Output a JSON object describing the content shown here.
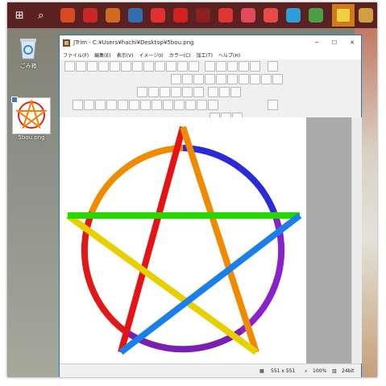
{
  "window": {
    "title": "JTrim - C:¥Users¥hachi¥Desktop¥5bou.png",
    "min_glyph": "─",
    "max_glyph": "☐",
    "close_glyph": "✕"
  },
  "menu": [
    {
      "label": "ファイル(F)"
    },
    {
      "label": "編集(E)"
    },
    {
      "label": "表示(V)"
    },
    {
      "label": "イメージ(I)"
    },
    {
      "label": "カラー(C)"
    },
    {
      "label": "加工(T)"
    },
    {
      "label": "ヘルプ(H)"
    }
  ],
  "taskbar": {
    "start_glyph": "⊞",
    "search_glyph": "⌕",
    "apps": [
      "#d94a20",
      "#c82828",
      "#d06a20",
      "#2f6fb0",
      "#e23030",
      "#d02020",
      "#8a2020",
      "#e03535",
      "#e24a5a",
      "#e84a4a",
      "#2f9ed8",
      "#47a047",
      "#cf7a20",
      "#d0a040"
    ]
  },
  "desktop": {
    "recycle_label": "ごみ箱",
    "file_label": "5bou.png"
  },
  "status": {
    "size": "551 x 551",
    "zoom": "100%",
    "depth": "24bit"
  },
  "colors": {
    "title_border": "#2a75c2",
    "taskbar_bg": "#5b2120"
  }
}
